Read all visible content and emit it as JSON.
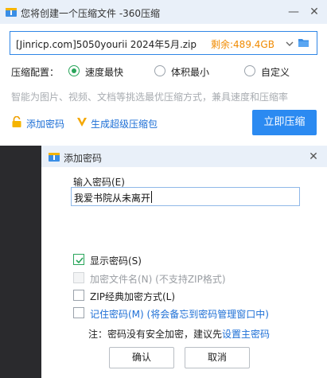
{
  "main": {
    "title": "您将创建一个压缩文件 -360压缩",
    "path_value": "[Jinricp.com]5050yourii 2024年5月.zip",
    "remaining": "剩余:489.4GB",
    "config_label": "压缩配置：",
    "options": [
      {
        "label": "速度最快",
        "selected": true
      },
      {
        "label": "体积最小",
        "selected": false
      },
      {
        "label": "自定义",
        "selected": false
      }
    ],
    "hint": "智能为图片、视频、文档等挑选最优压缩方式，兼具速度和压缩率",
    "add_password": "添加密码",
    "super_package": "生成超级压缩包",
    "compress_now": "立即压缩"
  },
  "dialog": {
    "title": "添加密码",
    "password_label": "输入密码(E)",
    "password_value": "我爱书院从未离开",
    "checkboxes": [
      {
        "label": "显示密码(S)",
        "checked": true,
        "disabled": false
      },
      {
        "label": "加密文件名(N)  (不支持ZIP格式)",
        "checked": false,
        "disabled": true
      },
      {
        "label": "ZIP经典加密方式(L)",
        "checked": false,
        "disabled": false
      },
      {
        "label": "记住密码(M)  (将会备忘到密码管理窗口中)",
        "checked": false,
        "disabled": false
      }
    ],
    "note": "注：密码没有安全加密，建议先",
    "note_link": "设置主密码",
    "ok": "确认",
    "cancel": "取消"
  },
  "colors": {
    "accent": "#2b8af1",
    "green": "#29a55a",
    "orange": "#f08a00",
    "link": "#1d6fd6"
  }
}
